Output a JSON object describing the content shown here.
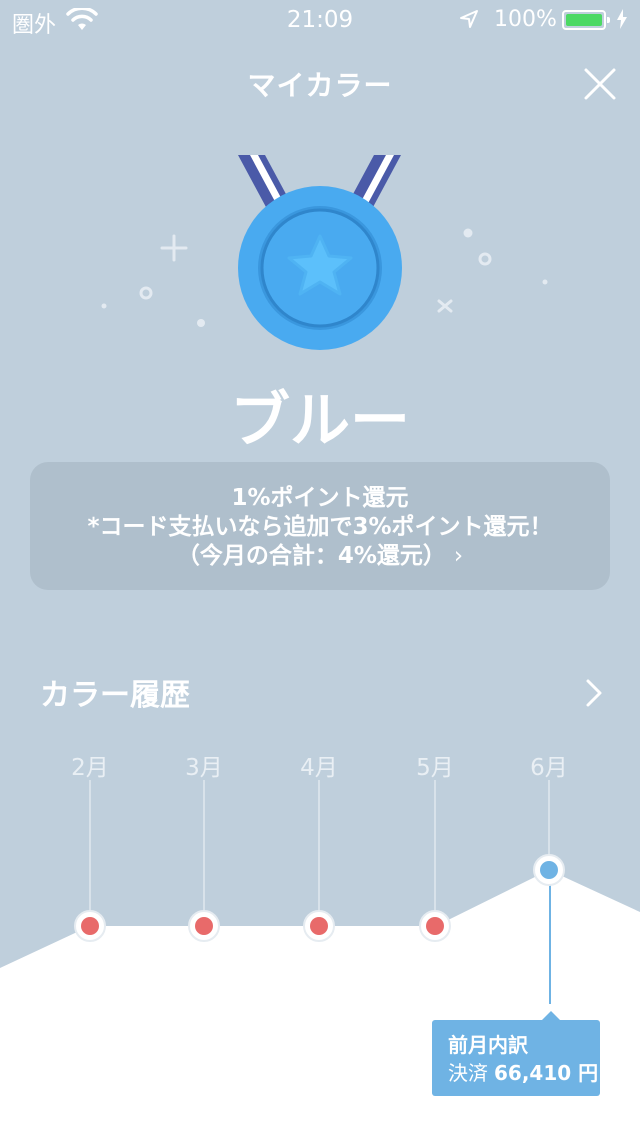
{
  "status_bar": {
    "carrier": "圏外",
    "time": "21:09",
    "battery_percent": "100%"
  },
  "header": {
    "title": "マイカラー",
    "close_icon": "close-icon"
  },
  "medal": {
    "icon": "medal-icon",
    "color": "#49aaf0",
    "color_name": "ブルー"
  },
  "info_card": {
    "line1": "1%ポイント還元",
    "line2": "*コード支払いなら追加で3%ポイント還元！",
    "line3": "（今月の合計：4%還元）",
    "chevron": "›"
  },
  "history": {
    "title": "カラー履歴",
    "months": [
      "2月",
      "3月",
      "4月",
      "5月",
      "6月"
    ],
    "levels": [
      "red",
      "red",
      "red",
      "red",
      "blue"
    ],
    "selected_index": 4
  },
  "tooltip": {
    "title": "前月内訳",
    "label": "決済",
    "amount": "66,410 円"
  },
  "colors": {
    "background": "#bfcfdc",
    "red_point": "#e86a6a",
    "blue_point": "#6fb3e4",
    "battery": "#4cd964"
  }
}
